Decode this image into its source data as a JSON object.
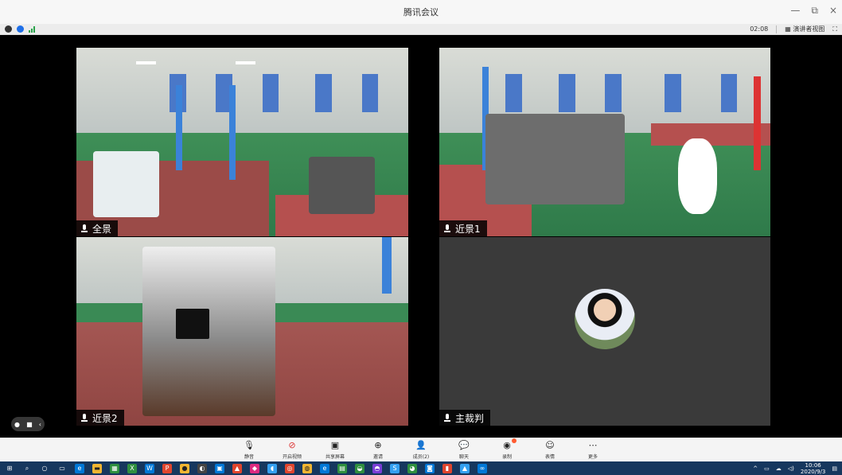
{
  "window": {
    "title": "腾讯会议",
    "controls": {
      "minimize": "—",
      "restore": "⧉",
      "close": "×"
    }
  },
  "status_bar": {
    "timer": "02:08",
    "view_mode_label": "演讲者视图",
    "fullscreen_icon": "fullscreen-icon"
  },
  "tiles": [
    {
      "id": "quanjing",
      "label": "全景",
      "kind": "camera"
    },
    {
      "id": "jinjing1",
      "label": "近景1",
      "kind": "camera"
    },
    {
      "id": "jinjing2",
      "label": "近景2",
      "kind": "camera"
    },
    {
      "id": "zhucaipan",
      "label": "主裁判",
      "kind": "avatar"
    }
  ],
  "toolbar": {
    "items": [
      {
        "name": "mute",
        "label": "静音",
        "icon": "mic-icon"
      },
      {
        "name": "start-video",
        "label": "开启视频",
        "icon": "camera-off-icon"
      },
      {
        "name": "share-screen",
        "label": "共享屏幕",
        "icon": "share-screen-icon"
      },
      {
        "name": "invite",
        "label": "邀请",
        "icon": "invite-icon"
      },
      {
        "name": "members",
        "label": "成员(2)",
        "icon": "members-icon"
      },
      {
        "name": "chat",
        "label": "聊天",
        "icon": "chat-icon"
      },
      {
        "name": "record",
        "label": "录制",
        "icon": "record-icon"
      },
      {
        "name": "reactions",
        "label": "表情",
        "icon": "emoji-icon"
      },
      {
        "name": "more",
        "label": "更多",
        "icon": "more-icon"
      }
    ]
  },
  "taskbar": {
    "time": "10:06",
    "date": "2020/9/3"
  },
  "colors": {
    "taskbar": "#16375e",
    "accent_blue": "#1e6fe8",
    "tile_dark": "#3a3a3a"
  }
}
